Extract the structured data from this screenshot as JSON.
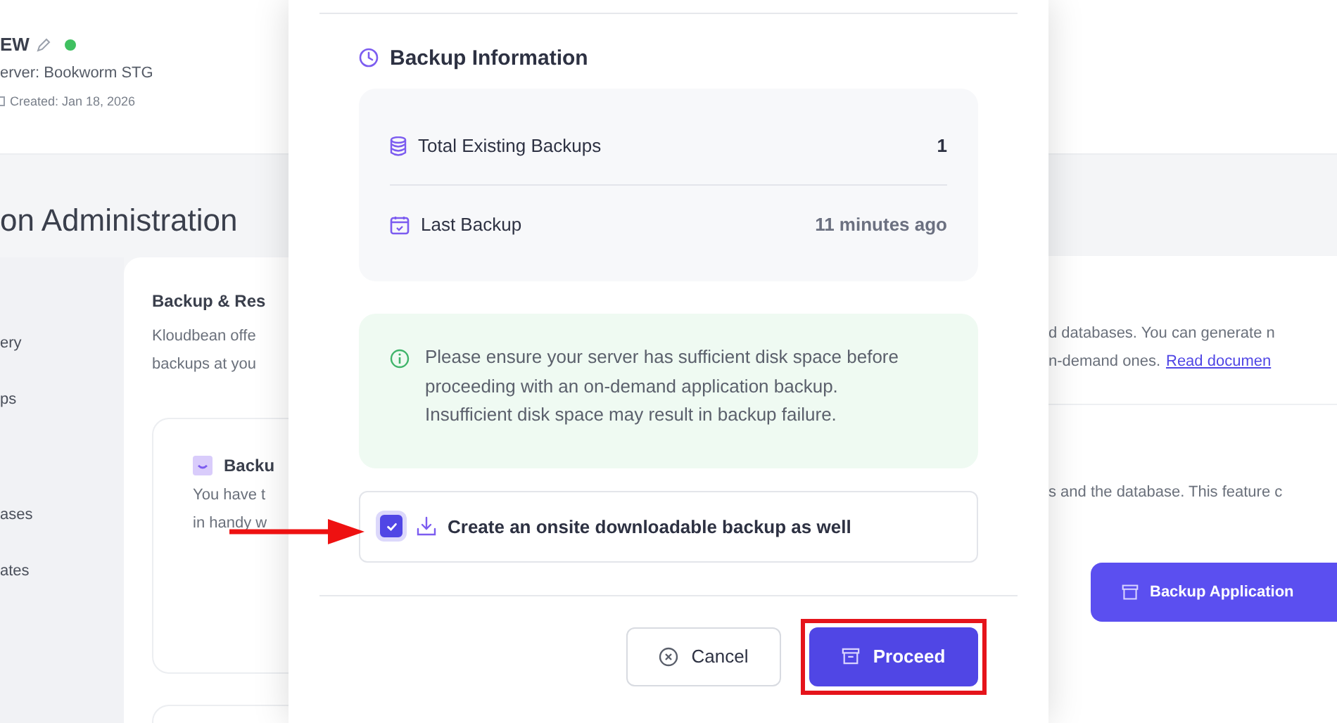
{
  "background": {
    "app_name": "EW",
    "server": "erver: Bookworm STG",
    "created": "Created: Jan 18, 2026",
    "page_title": "on Administration",
    "sidebar_items": [
      "ery",
      "ps",
      "ases",
      "ates"
    ],
    "section": {
      "title": "Backup & Res",
      "description_left": [
        "Kloudbean offe",
        "backups at you"
      ],
      "description_right": [
        "d databases. You can generate n",
        "n-demand ones."
      ],
      "link": "Read documen"
    },
    "card": {
      "title": "Backu",
      "description_left": [
        "You have t",
        "in handy w"
      ],
      "description_right": "s and the database. This feature c",
      "button": "Backup Application"
    }
  },
  "modal": {
    "section_title": "Backup Information",
    "stats": [
      {
        "kind": "count",
        "label": "Total Existing Backups",
        "value": "1"
      },
      {
        "kind": "date",
        "label": "Last Backup",
        "value": "11 minutes ago"
      }
    ],
    "notice": "Please ensure your server has sufficient disk space before proceeding with an on-demand application backup. Insufficient disk space may result in backup failure.",
    "checkbox": {
      "label": "Create an onsite downloadable backup as well",
      "checked": true,
      "pointed_at": true
    },
    "buttons": [
      {
        "kind": "secondary",
        "label": "Cancel",
        "highlighted": false
      },
      {
        "kind": "primary",
        "label": "Proceed",
        "highlighted": true
      }
    ]
  }
}
